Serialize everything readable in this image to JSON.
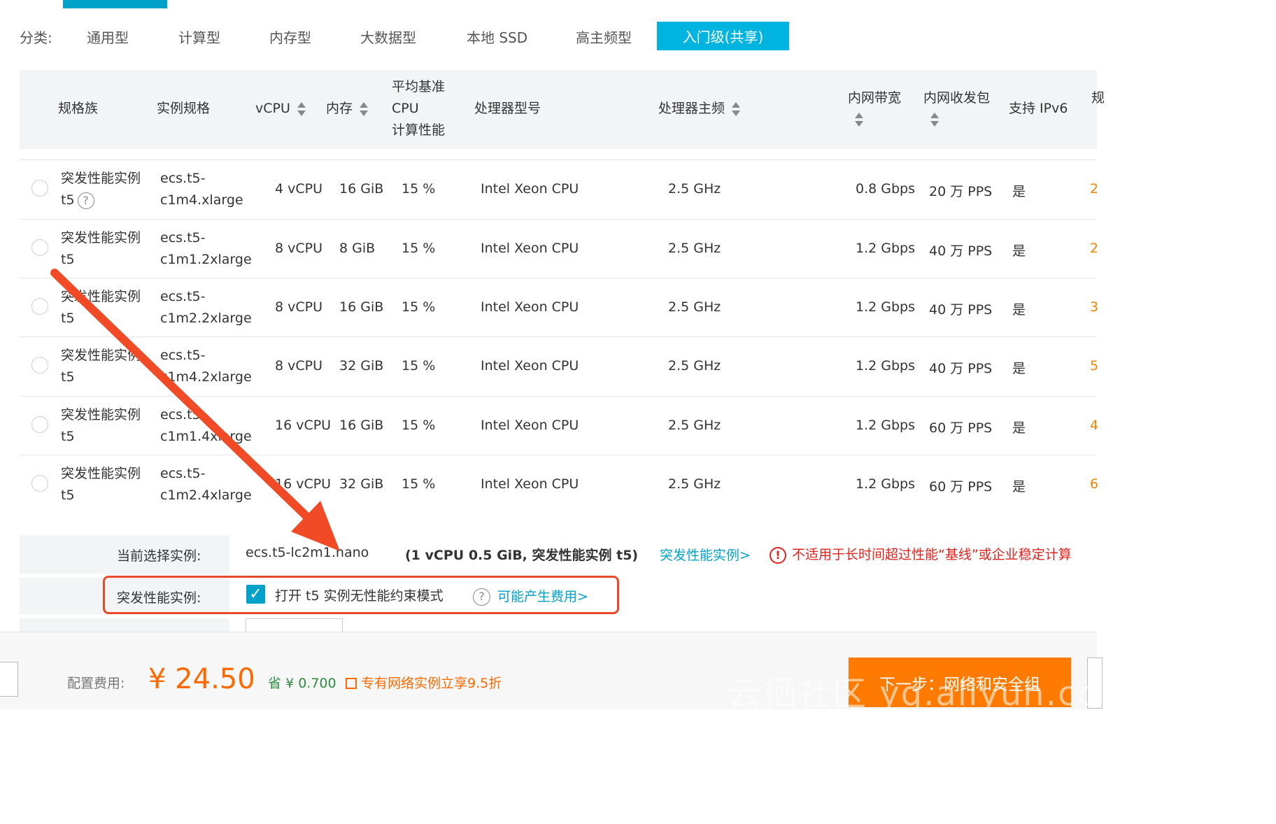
{
  "categories": {
    "label": "分类:",
    "items": [
      "通用型",
      "计算型",
      "内存型",
      "大数据型",
      "本地 SSD",
      "高主频型"
    ],
    "active": "入门级(共享)"
  },
  "table": {
    "headers": {
      "family": "规格族",
      "spec": "实例规格",
      "vcpu": "vCPU",
      "memory": "内存",
      "baseline_l1": "平均基准",
      "baseline_l2": "CPU",
      "baseline_l3": "计算性能",
      "cpu_model": "处理器型号",
      "clock": "处理器主频",
      "bandwidth": "内网带宽",
      "pps": "内网收发包",
      "ipv6": "支持 IPv6",
      "extra": "规"
    },
    "rows": [
      {
        "family_l1": "突发性能实例",
        "family_l2": "t5",
        "help": "?",
        "spec_l1": "ecs.t5-",
        "spec_l2": "c1m4.xlarge",
        "vcpu": "4 vCPU",
        "memory": "16 GiB",
        "baseline": "15 %",
        "cpu": "Intel Xeon CPU",
        "clock": "2.5 GHz",
        "bandwidth": "0.8 Gbps",
        "pps": "20 万 PPS",
        "ipv6": "是",
        "extra": "2"
      },
      {
        "family_l1": "突发性能实例",
        "family_l2": "t5",
        "spec_l1": "ecs.t5-",
        "spec_l2": "c1m1.2xlarge",
        "vcpu": "8 vCPU",
        "memory": "8 GiB",
        "baseline": "15 %",
        "cpu": "Intel Xeon CPU",
        "clock": "2.5 GHz",
        "bandwidth": "1.2 Gbps",
        "pps": "40 万 PPS",
        "ipv6": "是",
        "extra": "2"
      },
      {
        "family_l1": "突发性能实例",
        "family_l2": "t5",
        "spec_l1": "ecs.t5-",
        "spec_l2": "c1m2.2xlarge",
        "vcpu": "8 vCPU",
        "memory": "16 GiB",
        "baseline": "15 %",
        "cpu": "Intel Xeon CPU",
        "clock": "2.5 GHz",
        "bandwidth": "1.2 Gbps",
        "pps": "40 万 PPS",
        "ipv6": "是",
        "extra": "3"
      },
      {
        "family_l1": "突发性能实例",
        "family_l2": "t5",
        "spec_l1": "ecs.t5-",
        "spec_l2": "c1m4.2xlarge",
        "vcpu": "8 vCPU",
        "memory": "32 GiB",
        "baseline": "15 %",
        "cpu": "Intel Xeon CPU",
        "clock": "2.5 GHz",
        "bandwidth": "1.2 Gbps",
        "pps": "40 万 PPS",
        "ipv6": "是",
        "extra": "5"
      },
      {
        "family_l1": "突发性能实例",
        "family_l2": "t5",
        "spec_l1": "ecs.t5-",
        "spec_l2": "c1m1.4xlarge",
        "vcpu": "16 vCPU",
        "memory": "16 GiB",
        "baseline": "15 %",
        "cpu": "Intel Xeon CPU",
        "clock": "2.5 GHz",
        "bandwidth": "1.2 Gbps",
        "pps": "60 万 PPS",
        "ipv6": "是",
        "extra": "4"
      },
      {
        "family_l1": "突发性能实例",
        "family_l2": "t5",
        "spec_l1": "ecs.t5-",
        "spec_l2": "c1m2.4xlarge",
        "vcpu": "16 vCPU",
        "memory": "32 GiB",
        "baseline": "15 %",
        "cpu": "Intel Xeon CPU",
        "clock": "2.5 GHz",
        "bandwidth": "1.2 Gbps",
        "pps": "60 万 PPS",
        "ipv6": "是",
        "extra": "6"
      }
    ]
  },
  "selection": {
    "current_label": "当前选择实例:",
    "current_value": "ecs.t5-lc2m1.nano",
    "current_detail": "(1 vCPU 0.5 GiB, 突发性能实例 t5)",
    "burst_link": "突发性能实例>",
    "warning_icon": "!",
    "warning": "不适用于长时间超过性能“基线”或企业稳定计算",
    "burst_label": "突发性能实例:",
    "checkbox_text": "打开 t5 实例无性能约束模式",
    "help_icon": "?",
    "fee_link": "可能产生费用>"
  },
  "footer": {
    "fee_label": "配置费用:",
    "fee_amount": "¥ 24.50",
    "save_label": "省",
    "save_amount": "¥ 0.700",
    "promo": "专有网络实例立享9.5折",
    "next_button": "下一步：网络和安全组",
    "watermark": "云栖社区 yq.aliyun.com"
  },
  "colors": {
    "accent": "#00a2ca",
    "warning": "#e5211b",
    "price": "#ff6a00",
    "annotation": "#e94b2a"
  }
}
